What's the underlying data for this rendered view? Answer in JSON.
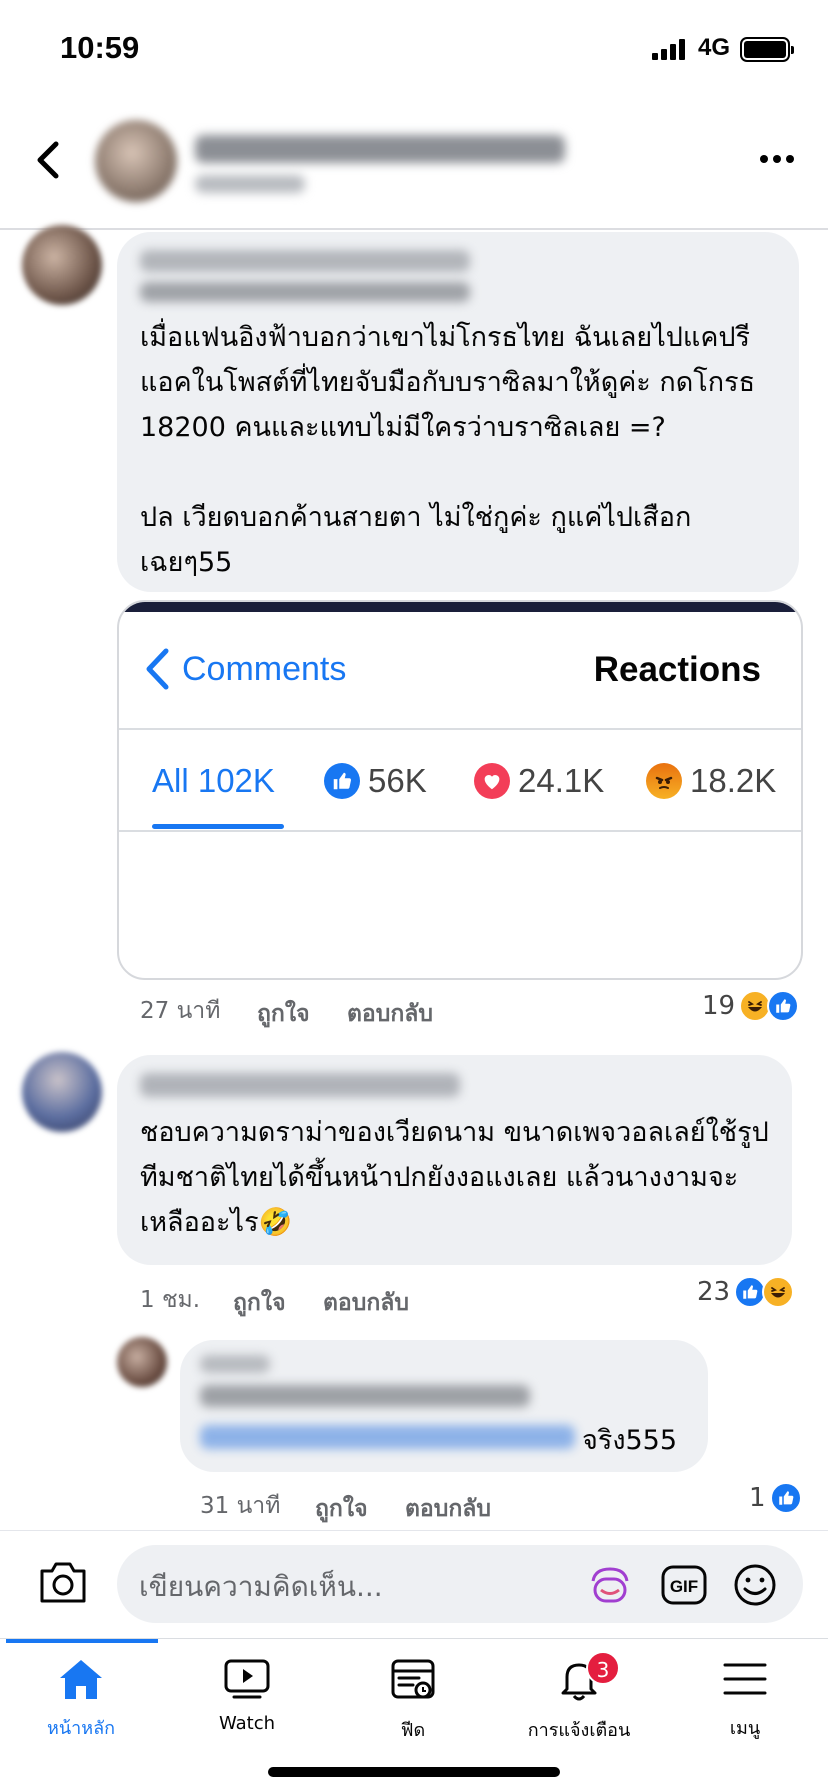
{
  "status_bar": {
    "time": "10:59",
    "network": "4G"
  },
  "comments": [
    {
      "text": "เมื่อแฟนอิงฟ้าบอกว่าเขาไม่โกรธไทย ฉันเลยไปแคปรีแอคในโพสต์ที่ไทยจับมือกับบราซิลมาให้ดูค่ะ กดโกรธ 18200 คนและแทบไม่มีใครว่าบราซิลเลย =?\n\nปล เวียดบอกค้านสายตา ไม่ใช่กูค่ะ กูแค่ไปเสือกเฉยๆ55",
      "time": "27 นาที",
      "like_label": "ถูกใจ",
      "reply_label": "ตอบกลับ",
      "reaction_count": "19",
      "reaction_icons": [
        "haha-icon",
        "like-icon"
      ]
    },
    {
      "text": "ชอบความดราม่าของเวียดนาม ขนาดเพจวอลเลย์ใช้รูปทีมชาติไทยได้ขึ้นหน้าปกยังงอแงเลย แล้วนางงามจะเหลืออะไร🤣",
      "time": "1 ชม.",
      "like_label": "ถูกใจ",
      "reply_label": "ตอบกลับ",
      "reaction_count": "23",
      "reaction_icons": [
        "like-icon",
        "haha-icon"
      ]
    },
    {
      "text": "จริง555",
      "time": "31 นาที",
      "like_label": "ถูกใจ",
      "reply_label": "ตอบกลับ",
      "reaction_count": "1",
      "reaction_icons": [
        "like-icon"
      ]
    }
  ],
  "embedded_screenshot": {
    "back_label": "Comments",
    "title": "Reactions",
    "tabs": [
      {
        "label": "All 102K",
        "active": true
      },
      {
        "label": "56K",
        "icon": "like-icon"
      },
      {
        "label": "24.1K",
        "icon": "love-icon"
      },
      {
        "label": "18.2K",
        "icon": "angry-icon"
      }
    ]
  },
  "composer": {
    "placeholder": "เขียนความคิดเห็น...",
    "gif_label": "GIF"
  },
  "nav": {
    "items": [
      {
        "label": "หน้าหลัก",
        "icon": "home-icon",
        "active": true
      },
      {
        "label": "Watch",
        "icon": "watch-icon"
      },
      {
        "label": "ฟีด",
        "icon": "feed-icon"
      },
      {
        "label": "การแจ้งเตือน",
        "icon": "bell-icon",
        "badge": "3"
      },
      {
        "label": "เมนู",
        "icon": "menu-icon"
      }
    ]
  },
  "colors": {
    "accent": "#1877f2",
    "bubble": "#eef0f3",
    "badge": "#e41e3f",
    "angry": "#e9710f",
    "love": "#f33e58"
  }
}
